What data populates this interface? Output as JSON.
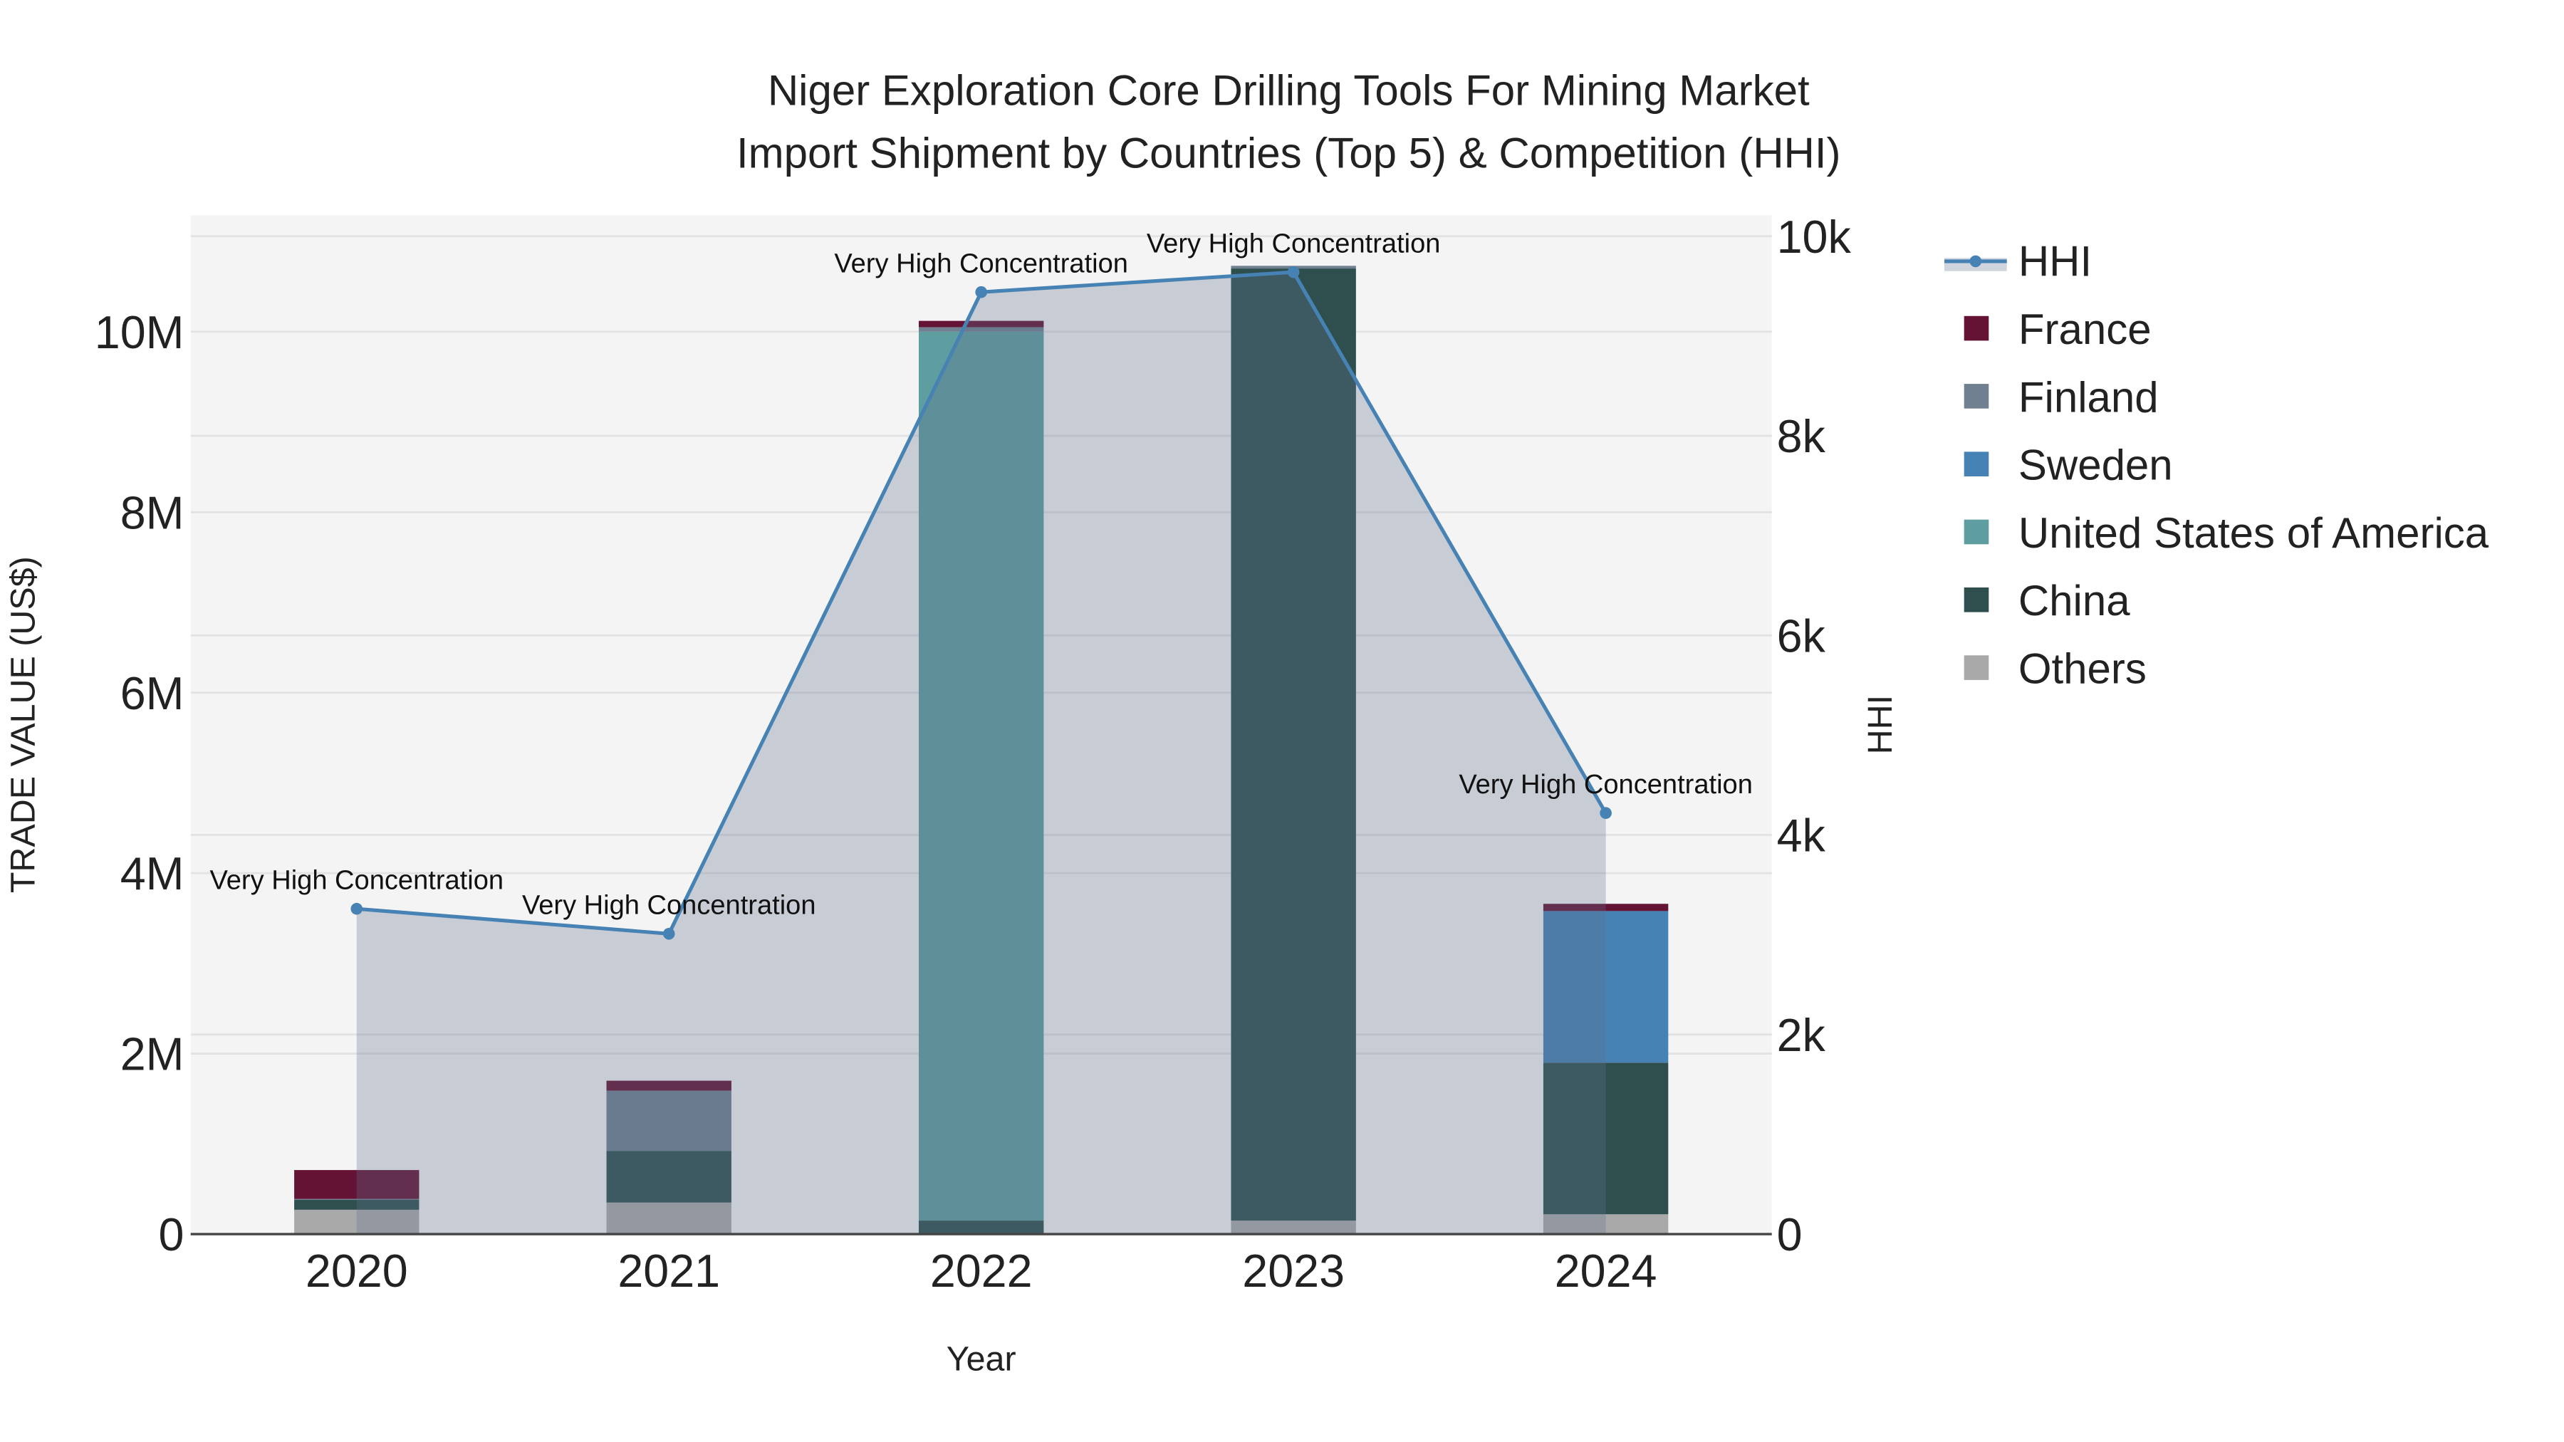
{
  "chart_data": {
    "type": "bar",
    "title_line1": "Niger Exploration Core Drilling Tools For Mining Market",
    "title_line2": "Import Shipment by Countries (Top 5) & Competition (HHI)",
    "xlabel": "Year",
    "ylabel": "TRADE VALUE (US$)",
    "y2label": "HHI",
    "categories": [
      "2020",
      "2021",
      "2022",
      "2023",
      "2024"
    ],
    "ylim": [
      0,
      11290000
    ],
    "y2lim": [
      0,
      10210
    ],
    "yticks": [
      {
        "v": 0,
        "label": "0"
      },
      {
        "v": 2000000,
        "label": "2M"
      },
      {
        "v": 4000000,
        "label": "4M"
      },
      {
        "v": 6000000,
        "label": "6M"
      },
      {
        "v": 8000000,
        "label": "8M"
      },
      {
        "v": 10000000,
        "label": "10M"
      }
    ],
    "y2ticks": [
      {
        "v": 0,
        "label": "0"
      },
      {
        "v": 2000,
        "label": "2k"
      },
      {
        "v": 4000,
        "label": "4k"
      },
      {
        "v": 6000,
        "label": "6k"
      },
      {
        "v": 8000,
        "label": "8k"
      },
      {
        "v": 10000,
        "label": "10k"
      }
    ],
    "grid": true,
    "legend_position": "right",
    "stack_order": [
      "Others",
      "China",
      "United States of America",
      "Sweden",
      "Finland",
      "France"
    ],
    "series": [
      {
        "name": "France",
        "color": "#641334",
        "values": [
          320000,
          110000,
          70000,
          0,
          80000
        ]
      },
      {
        "name": "Finland",
        "color": "#708090",
        "values": [
          10000,
          670000,
          50000,
          30000,
          0
        ]
      },
      {
        "name": "Sweden",
        "color": "#4682b4",
        "values": [
          0,
          0,
          0,
          0,
          1680000
        ]
      },
      {
        "name": "United States of America",
        "color": "#5f9ea0",
        "values": [
          0,
          0,
          9850000,
          0,
          0
        ]
      },
      {
        "name": "China",
        "color": "#2f4f4f",
        "values": [
          110000,
          570000,
          150000,
          10550000,
          1680000
        ]
      },
      {
        "name": "Others",
        "color": "#a9a9a9",
        "values": [
          270000,
          350000,
          0,
          150000,
          220000
        ]
      }
    ],
    "hhi": {
      "name": "HHI",
      "color": "#4682b4",
      "values": [
        3260,
        3010,
        9440,
        9640,
        4220
      ],
      "annotations": [
        "Very High Concentration",
        "Very High Concentration",
        "Very High Concentration",
        "Very High Concentration",
        "Very High Concentration"
      ]
    },
    "legend": [
      "HHI",
      "France",
      "Finland",
      "Sweden",
      "United States of America",
      "China",
      "Others"
    ]
  }
}
